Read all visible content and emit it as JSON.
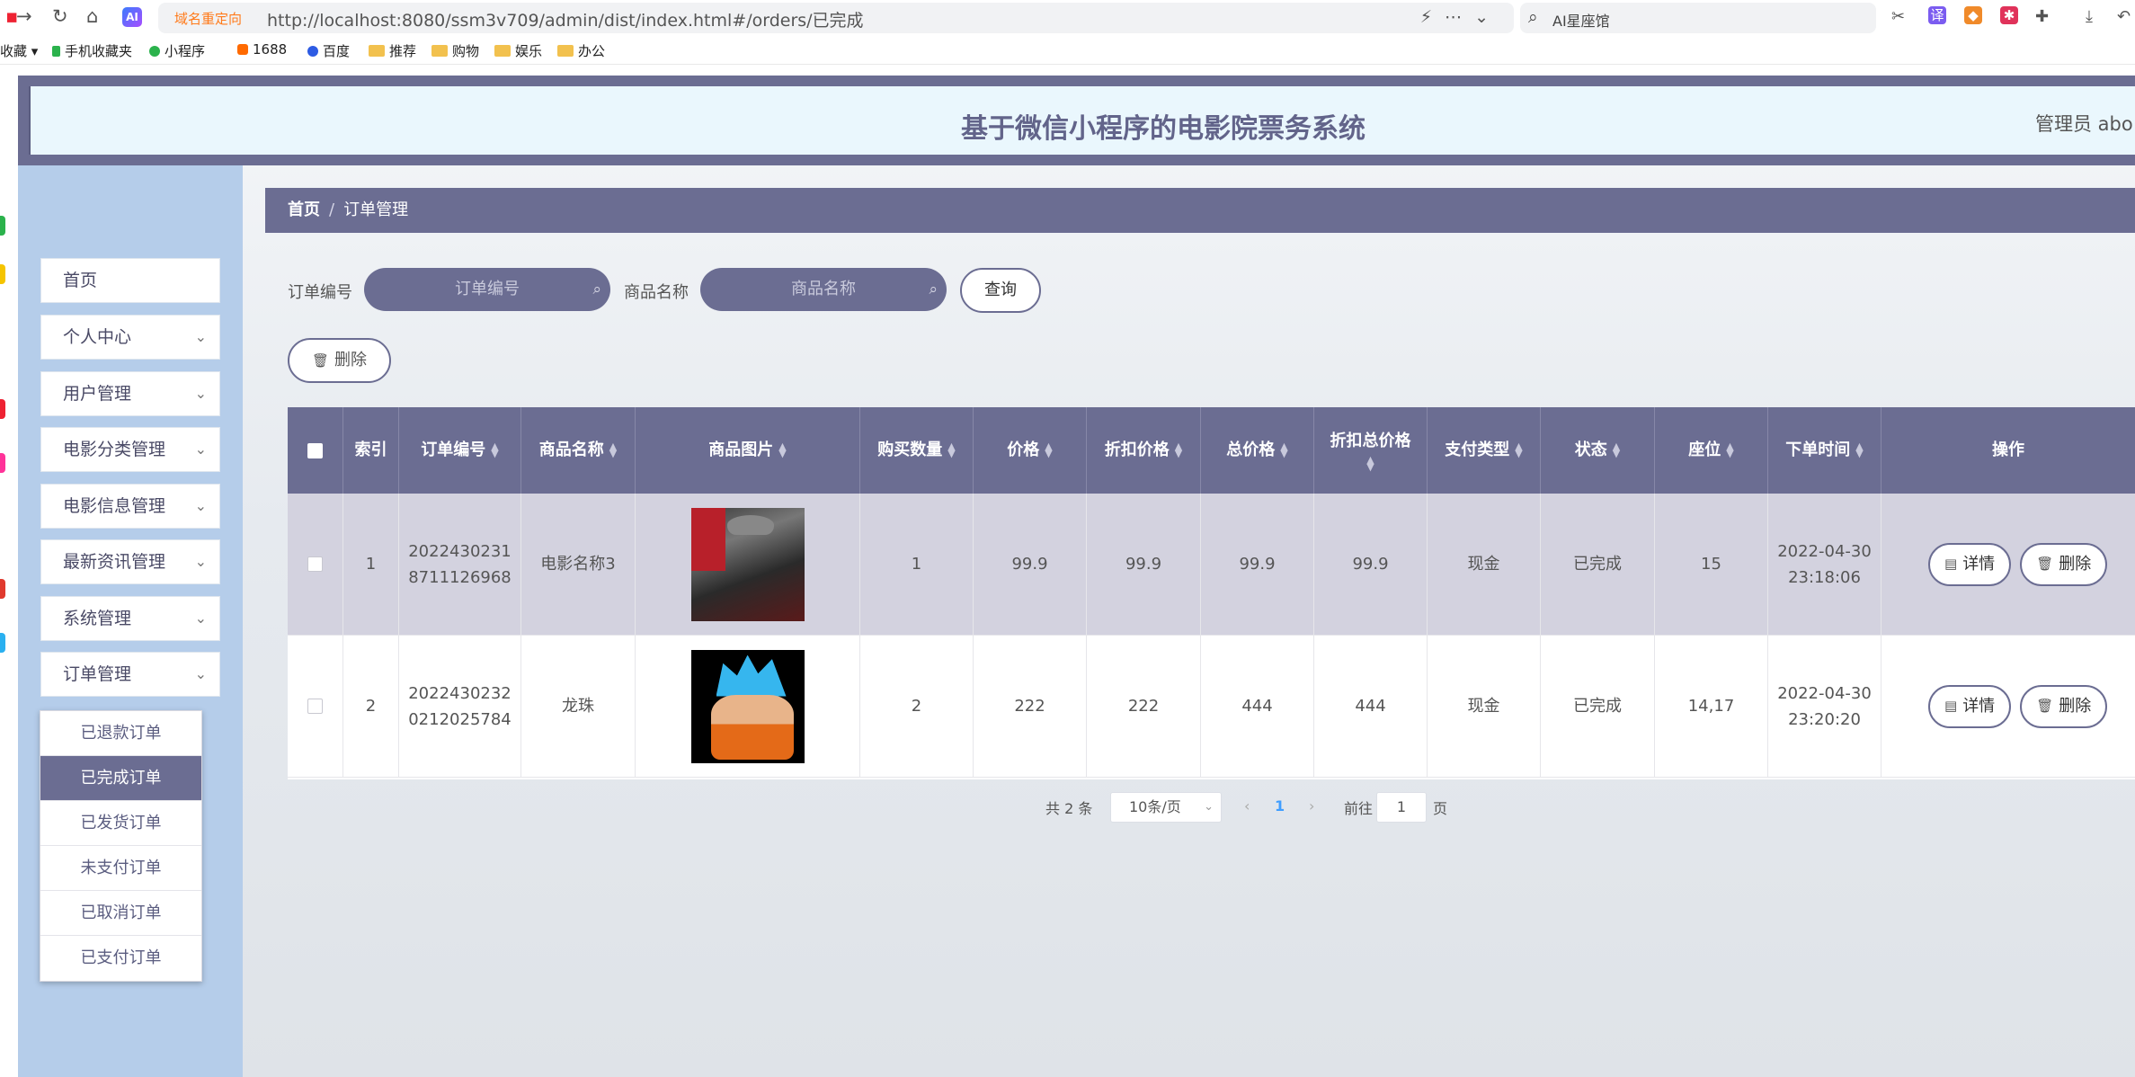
{
  "browser": {
    "redirect_label": "域名重定向",
    "url": "http://localhost:8080/ssm3v709/admin/dist/index.html#/orders/已完成",
    "search_text": "AI星座馆",
    "ai_badge": "AI",
    "bookmarks": [
      {
        "label": "收藏",
        "icon": "star-icon"
      },
      {
        "label": "手机收藏夹",
        "icon": "phone-icon"
      },
      {
        "label": "小程序",
        "icon": "mini-program-icon"
      },
      {
        "label": "1688",
        "icon": "1688-icon"
      },
      {
        "label": "百度",
        "icon": "baidu-icon"
      },
      {
        "label": "推荐",
        "icon": "folder-icon"
      },
      {
        "label": "购物",
        "icon": "folder-icon"
      },
      {
        "label": "娱乐",
        "icon": "folder-icon"
      },
      {
        "label": "办公",
        "icon": "folder-icon"
      }
    ]
  },
  "header": {
    "title": "基于微信小程序的电影院票务系统",
    "admin": "管理员 abo"
  },
  "sidebar": {
    "items": [
      {
        "label": "首页",
        "has_arrow": false
      },
      {
        "label": "个人中心",
        "has_arrow": true
      },
      {
        "label": "用户管理",
        "has_arrow": true
      },
      {
        "label": "电影分类管理",
        "has_arrow": true
      },
      {
        "label": "电影信息管理",
        "has_arrow": true
      },
      {
        "label": "最新资讯管理",
        "has_arrow": true
      },
      {
        "label": "系统管理",
        "has_arrow": true
      },
      {
        "label": "订单管理",
        "has_arrow": true
      }
    ],
    "submenu": [
      "已退款订单",
      "已完成订单",
      "已发货订单",
      "未支付订单",
      "已取消订单",
      "已支付订单"
    ],
    "submenu_active": "已完成订单"
  },
  "breadcrumb": {
    "home": "首页",
    "sep": "/",
    "current": "订单管理"
  },
  "filters": {
    "order_no_label": "订单编号",
    "order_no_placeholder": "订单编号",
    "product_label": "商品名称",
    "product_placeholder": "商品名称",
    "query_button": "查询",
    "delete_button": "删除"
  },
  "table": {
    "columns": [
      "索引",
      "订单编号",
      "商品名称",
      "商品图片",
      "购买数量",
      "价格",
      "折扣价格",
      "总价格",
      "折扣总价格",
      "支付类型",
      "状态",
      "座位",
      "下单时间",
      "操作"
    ],
    "rows": [
      {
        "index": "1",
        "order_no_l1": "2022430231",
        "order_no_l2": "8711126968",
        "product": "电影名称3",
        "qty": "1",
        "price": "99.9",
        "discount_price": "99.9",
        "total": "99.9",
        "discount_total": "99.9",
        "pay_type": "现金",
        "status": "已完成",
        "seat": "15",
        "date": "2022-04-30",
        "time": "23:18:06"
      },
      {
        "index": "2",
        "order_no_l1": "2022430232",
        "order_no_l2": "0212025784",
        "product": "龙珠",
        "qty": "2",
        "price": "222",
        "discount_price": "222",
        "total": "444",
        "discount_total": "444",
        "pay_type": "现金",
        "status": "已完成",
        "seat": "14,17",
        "date": "2022-04-30",
        "time": "23:20:20"
      }
    ],
    "actions": {
      "detail": "详情",
      "delete": "删除"
    }
  },
  "pagination": {
    "total": "共 2 条",
    "page_size": "10条/页",
    "current_page": "1",
    "goto_label": "前往",
    "goto_value": "1",
    "page_unit": "页"
  }
}
